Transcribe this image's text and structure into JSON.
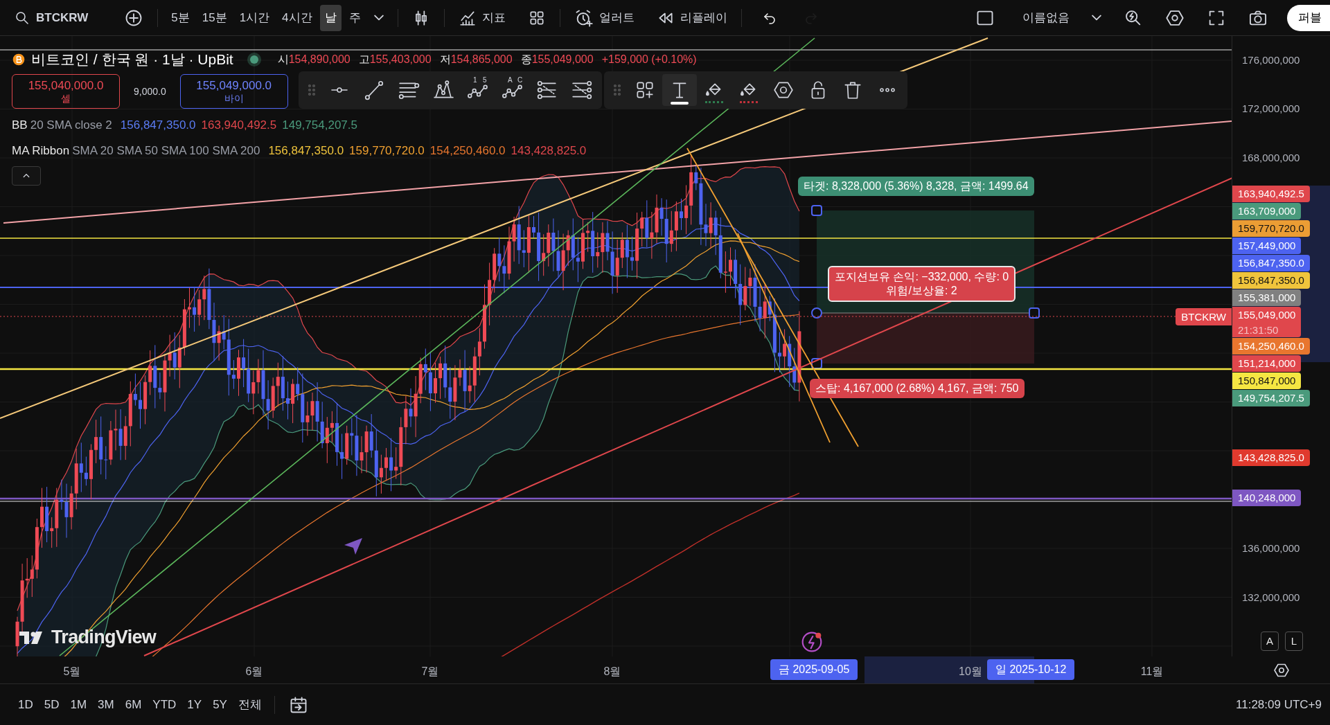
{
  "toolbar": {
    "symbol": "BTCKRW",
    "intervals": [
      {
        "label": "5분",
        "selected": false
      },
      {
        "label": "15분",
        "selected": false
      },
      {
        "label": "1시간",
        "selected": false
      },
      {
        "label": "4시간",
        "selected": false
      },
      {
        "label": "날",
        "selected": true
      },
      {
        "label": "주",
        "selected": false
      }
    ],
    "indicators_label": "지표",
    "alert_label": "얼러트",
    "replay_label": "리플레이",
    "history": [
      {
        "kind": "undo",
        "disabled": false
      },
      {
        "kind": "redo",
        "disabled": true
      }
    ],
    "layout_name": "이름없음",
    "publish_label": "퍼블"
  },
  "legend": {
    "title": "비트코인 / 한국 원 · 1날 · UpBit",
    "ohlc": [
      {
        "key": "시",
        "value": "154,890,000"
      },
      {
        "key": "고",
        "value": "155,403,000"
      },
      {
        "key": "저",
        "value": "154,865,000"
      },
      {
        "key": "종",
        "value": "155,049,000"
      }
    ],
    "change": "+159,000 (+0.10%)"
  },
  "trade": {
    "sell_price": "155,040,000.0",
    "sell_label": "셀",
    "spread": "9,000.0",
    "buy_price": "155,049,000.0",
    "buy_label": "바이"
  },
  "indicators": [
    {
      "name": "BB",
      "params": "20 SMA close 2",
      "values": [
        {
          "text": "156,847,350.0",
          "color": "#5b7cf5"
        },
        {
          "text": "163,940,492.5",
          "color": "#e0474c"
        },
        {
          "text": "149,754,207.5",
          "color": "#4a9a7c"
        }
      ]
    },
    {
      "name": "MA Ribbon",
      "params": "SMA 20 SMA 50 SMA 100 SMA 200",
      "values": [
        {
          "text": "156,847,350.0",
          "color": "#f0c43c"
        },
        {
          "text": "159,770,720.0",
          "color": "#f0a030"
        },
        {
          "text": "154,250,460.0",
          "color": "#e8762e"
        },
        {
          "text": "143,428,825.0",
          "color": "#e0474c"
        }
      ]
    }
  ],
  "drawing_tools": [
    [
      {
        "kind": "horizontal-ray",
        "selected": false
      },
      {
        "kind": "trend-line",
        "selected": false
      },
      {
        "kind": "parallel-lines",
        "selected": false
      },
      {
        "kind": "pattern",
        "selected": false
      },
      {
        "kind": "wave",
        "selected": false,
        "label_a": "1",
        "label_b": "5"
      },
      {
        "kind": "wave",
        "selected": false,
        "label_a": "A",
        "label_b": "C"
      },
      {
        "kind": "fib-a",
        "selected": false
      },
      {
        "kind": "fib-b",
        "selected": false
      }
    ],
    [
      {
        "kind": "object-tree",
        "selected": false
      },
      {
        "kind": "text",
        "selected": true
      },
      {
        "kind": "fill",
        "selected": false,
        "color": "#2e7d4f"
      },
      {
        "kind": "fill",
        "selected": false,
        "color": "#c0303a"
      },
      {
        "kind": "settings",
        "selected": false
      },
      {
        "kind": "lock",
        "selected": false
      },
      {
        "kind": "delete",
        "selected": false
      },
      {
        "kind": "more",
        "selected": false
      }
    ]
  ],
  "position": {
    "target": "타겟: 8,328,000 (5.36%) 8,328, 금액: 1499.64",
    "status": [
      "포지션보유 손익: −332,000, 수량: 0",
      "위험/보상율: 2"
    ],
    "stop": "스탑: 4,167,000 (2.68%) 4,167, 금액: 750"
  },
  "symbol_tag": "BTCKRW",
  "brand": "TradingView",
  "price_axis": {
    "ticks": [
      "176,000,000",
      "172,000,000",
      "168,000,000",
      "136,000,000",
      "132,000,000"
    ],
    "tags": [
      {
        "text": "163,940,492.5",
        "color": "#e0474c",
        "dark_text": false
      },
      {
        "text": "163,709,000",
        "color": "#4a9a7c",
        "dark_text": false
      },
      {
        "text": "159,770,720.0",
        "color": "#eb9d34",
        "dark_text": true
      },
      {
        "text": "157,449,000",
        "color": "#4d63f0",
        "dark_text": false
      },
      {
        "text": "156,847,350.0",
        "color": "#4d63f0",
        "dark_text": false
      },
      {
        "text": "156,847,350.0",
        "color": "#f0c43c",
        "dark_text": true
      },
      {
        "text": "155,381,000",
        "color": "#808080",
        "dark_text": false
      },
      {
        "text": "155,049,000",
        "timer": "21:31:50",
        "color": "#e0474c",
        "dark_text": false
      },
      {
        "text": "154,250,460.0",
        "color": "#e8762e",
        "dark_text": false
      },
      {
        "text": "151,214,000",
        "color": "#e0474c",
        "dark_text": false
      },
      {
        "text": "150,847,000",
        "color": "#f5e642",
        "dark_text": true
      },
      {
        "text": "149,754,207.5",
        "color": "#4a9a7c",
        "dark_text": false
      },
      {
        "text": "143,428,825.0",
        "color": "#e03a2e",
        "dark_text": false
      },
      {
        "text": "140,248,000",
        "color": "#7e57c2",
        "dark_text": false
      }
    ],
    "scale_buttons": [
      "A",
      "L"
    ]
  },
  "time_axis": {
    "ticks": [
      "5월",
      "6월",
      "7월",
      "8월",
      "10월",
      "11월"
    ],
    "range_start": "금 2025-09-05",
    "range_end": "일 2025-10-12"
  },
  "ranges": [
    "1D",
    "5D",
    "1M",
    "3M",
    "6M",
    "YTD",
    "1Y",
    "5Y",
    "전체"
  ],
  "clock": "11:28:09 UTC+9"
}
